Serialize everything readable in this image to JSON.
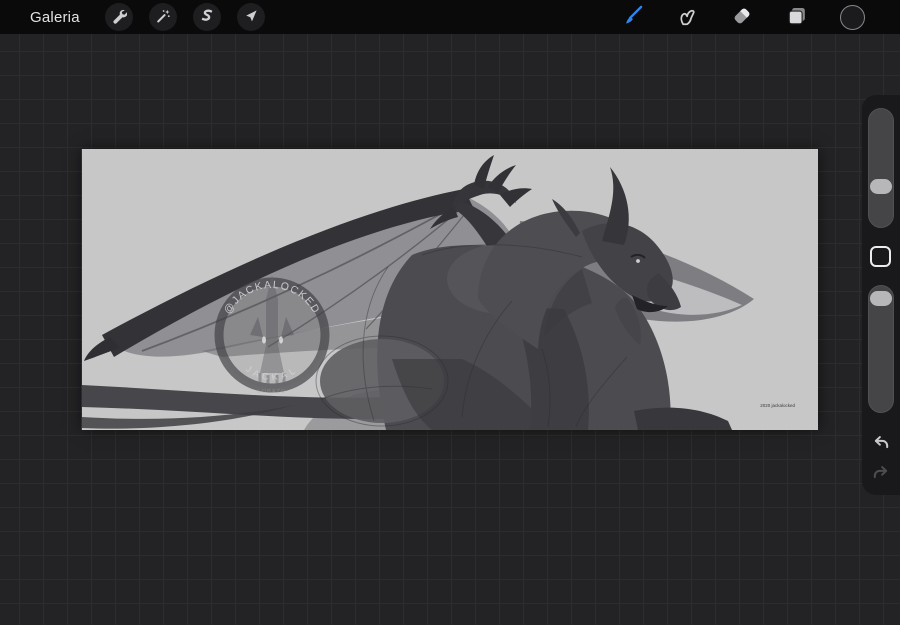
{
  "topbar": {
    "gallery_label": "Galeria",
    "left_tools": [
      {
        "id": "actions",
        "icon": "wrench-icon"
      },
      {
        "id": "adjustments",
        "icon": "magic-wand-icon"
      },
      {
        "id": "selection",
        "icon": "selection-s-icon"
      },
      {
        "id": "transform",
        "icon": "transform-arrow-icon"
      }
    ],
    "right_tools": [
      {
        "id": "paint",
        "icon": "brush-icon",
        "active": true,
        "accent_color": "#2e86ee"
      },
      {
        "id": "smudge",
        "icon": "smudge-icon"
      },
      {
        "id": "erase",
        "icon": "eraser-icon"
      },
      {
        "id": "layers",
        "icon": "layers-icon"
      },
      {
        "id": "color",
        "icon": "color-swatch",
        "current_color": "#1b1b1d"
      }
    ]
  },
  "canvas": {
    "background_color": "#c7c7c8",
    "artwork_subject": "grayscale dragon sketch with spread wing",
    "watermark": {
      "top_text": "@JACKALOCKED",
      "bottom_text": "JACKAL",
      "subtext": "LOBAZO"
    },
    "signature": "2020 jackalocked"
  },
  "sidebar": {
    "brush_size_handle_percent": 62,
    "opacity_handle_percent": 5,
    "controls": [
      "brush-size-slider",
      "modify-button",
      "opacity-slider",
      "undo-button",
      "redo-button"
    ]
  }
}
